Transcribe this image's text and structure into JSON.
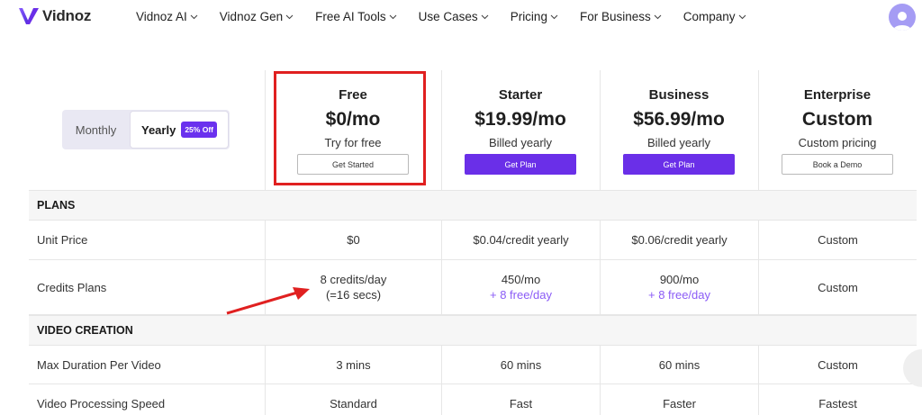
{
  "brand": {
    "name": "Vidnoz",
    "accent": "#6a2fe8",
    "highlight": "#e02020"
  },
  "nav": {
    "items": [
      {
        "label": "Vidnoz AI"
      },
      {
        "label": "Vidnoz Gen"
      },
      {
        "label": "Free AI Tools"
      },
      {
        "label": "Use Cases"
      },
      {
        "label": "Pricing"
      },
      {
        "label": "For Business"
      },
      {
        "label": "Company"
      }
    ],
    "avatar_icon": "user-avatar-icon"
  },
  "billing_toggle": {
    "monthly": "Monthly",
    "yearly": "Yearly",
    "discount_badge": "25% Off",
    "selected": "Yearly"
  },
  "plans": [
    {
      "name": "Free",
      "price": "$0/mo",
      "subtitle": "Try for free",
      "button": "Get Started"
    },
    {
      "name": "Starter",
      "price": "$19.99/mo",
      "subtitle": "Billed yearly",
      "button": "Get Plan"
    },
    {
      "name": "Business",
      "price": "$56.99/mo",
      "subtitle": "Billed yearly",
      "button": "Get Plan"
    },
    {
      "name": "Enterprise",
      "price": "Custom",
      "subtitle": "Custom pricing",
      "button": "Book a Demo"
    }
  ],
  "table": {
    "sections": [
      {
        "title": "PLANS",
        "rows": [
          {
            "label": "Unit Price",
            "values": [
              "$0",
              "$0.04/credit yearly",
              "$0.06/credit yearly",
              "Custom"
            ]
          },
          {
            "label": "Credits Plans",
            "values": [
              "8 credits/day",
              "450/mo",
              "900/mo",
              "Custom"
            ],
            "extra": [
              "(=16 secs)",
              "+ 8 free/day",
              "+ 8 free/day",
              ""
            ]
          }
        ]
      },
      {
        "title": "VIDEO CREATION",
        "rows": [
          {
            "label": "Max Duration Per Video",
            "values": [
              "3 mins",
              "60 mins",
              "60 mins",
              "Custom"
            ]
          },
          {
            "label": "Video Processing Speed",
            "values": [
              "Standard",
              "Fast",
              "Faster",
              "Fastest"
            ]
          }
        ]
      }
    ]
  }
}
